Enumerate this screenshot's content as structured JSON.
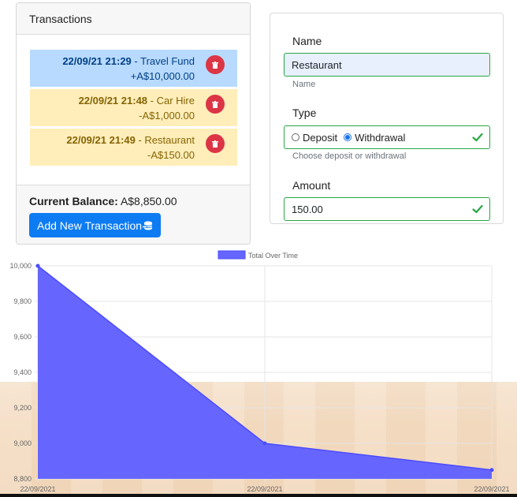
{
  "transactions": {
    "title": "Transactions",
    "items": [
      {
        "datetime": "22/09/21 21:29",
        "sep": " - ",
        "name": "Travel Fund",
        "amount": "+A$10,000.00",
        "kind": "deposit"
      },
      {
        "datetime": "22/09/21 21:48",
        "sep": " - ",
        "name": "Car Hire",
        "amount": "-A$1,000.00",
        "kind": "withdrawal"
      },
      {
        "datetime": "22/09/21 21:49",
        "sep": " - ",
        "name": "Restaurant",
        "amount": "-A$150.00",
        "kind": "withdrawal"
      }
    ],
    "balance_label": "Current Balance:",
    "balance_value": "A$8,850.00",
    "add_button": "Add New Transaction",
    "add_icon": "coins-icon",
    "delete_icon": "trash-icon"
  },
  "form": {
    "name_label": "Name",
    "name_value": "Restaurant",
    "name_help": "Name",
    "type_label": "Type",
    "type_options": [
      "Deposit",
      "Withdrawal"
    ],
    "type_selected": "Withdrawal",
    "type_help": "Choose deposit or withdrawal",
    "amount_label": "Amount",
    "amount_value": "150.00",
    "valid_color": "#28a745"
  },
  "chart_data": {
    "type": "area",
    "legend": "Total Over Time",
    "legend_position": "top",
    "x": [
      "22/09/2021",
      "22/09/2021",
      "22/09/2021"
    ],
    "values": [
      10000,
      9000,
      8850
    ],
    "ylim": [
      8800,
      10000
    ],
    "yticks": [
      "10,000",
      "9,800",
      "9,600",
      "9,400",
      "9,200",
      "9,000",
      "8,800"
    ],
    "grid": true,
    "fill_color": "#6666ff",
    "line_color": "#4b4bff"
  }
}
